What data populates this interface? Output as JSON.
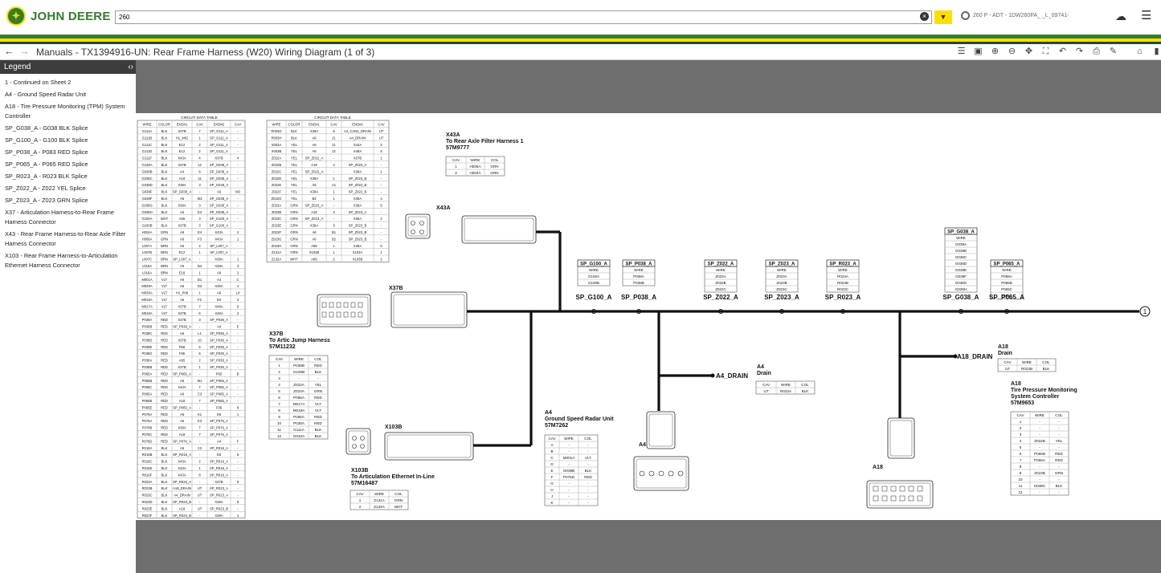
{
  "header": {
    "brand": "JOHN DEERE",
    "search_value": "260",
    "machine": "260 P - ADT - 1DW260PA_ _L_09741-"
  },
  "document": {
    "title": "Manuals - TX1394916-UN: Rear Frame Harness (W20) Wiring Diagram (1 of 3)"
  },
  "legend": {
    "title": "Legend",
    "items": [
      "1 - Continued on Sheet 2",
      "A4 - Ground Speed Radar Unit",
      "A18 - Tire Pressure Monitoring (TPM) System Controller",
      "SP_G038_A - G038 BLK Splice",
      "SP_G100_A - G100 BLK Splice",
      "SP_P038_A - P083 RED Splice",
      "SP_P065_A - P065 RED Splice",
      "SP_R023_A - R023 BLK Splice",
      "SP_Z022_A - Z022 YEL Splice",
      "SP_Z023_A - Z023 GRN Splice",
      "X37 - Articulation Harness-to-Rear Frame Harness Connector",
      "X43 - Rear Frame Harness-to-Rear Axle Filter Harness Connector",
      "X103 - Rear Frame Harness-to-Articulation Ethernet Harness Connector"
    ]
  },
  "diagram": {
    "table_title": "CIRCUIT DATA TABLE",
    "circuit_headers": [
      "WIRE",
      "COLOR",
      "END#1",
      "CAV",
      "END#2",
      "CAV"
    ],
    "cdt1_rows": [
      [
        "G111A",
        "BLK",
        "X37B",
        "7",
        "SP_G111_A",
        "-"
      ],
      [
        "G111B",
        "BLK",
        "H1_MIG",
        "1",
        "SP_G111_A",
        "-"
      ],
      [
        "G111C",
        "BLK",
        "E12",
        "2",
        "SP_G111_A",
        "-"
      ],
      [
        "G111D",
        "BLK",
        "E12",
        "2",
        "SP_G111_A",
        "-"
      ],
      [
        "G111F",
        "BLK",
        "X43A",
        "4",
        "X37B",
        "4"
      ],
      [
        "G138A",
        "BLK",
        "X37B",
        "12",
        "SP_G038_A",
        "-"
      ],
      [
        "G038B",
        "BLK",
        "A4",
        "6",
        "SP_G038_A",
        "-"
      ],
      [
        "G038C",
        "BLK",
        "A18",
        "11",
        "SP_G038_A",
        "-"
      ],
      [
        "G038D",
        "BLK",
        "X38A",
        "3",
        "SP_G038_A",
        "-"
      ],
      [
        "G038F",
        "BLK",
        "SP_G038_A",
        "-",
        "A6",
        "M3"
      ],
      [
        "G038F",
        "BLK",
        "A6",
        "M3",
        "SP_G038_A",
        "-"
      ],
      [
        "G038G",
        "BLK",
        "X38A",
        "3",
        "SP_G038_A",
        "-"
      ],
      [
        "G038H",
        "BLK",
        "A6",
        "E3",
        "SP_G038_A",
        "-"
      ],
      [
        "G100A",
        "WHT",
        "A65",
        "3",
        "SP_G100_A",
        "-"
      ],
      [
        "G100B",
        "BLK",
        "X37B",
        "3",
        "SP_G100_A",
        "-"
      ],
      [
        "H004A",
        "GRN",
        "A6",
        "E4",
        "X43A",
        "2"
      ],
      [
        "H006A",
        "GRN",
        "A6",
        "F3",
        "X43A",
        "1"
      ],
      [
        "L007A",
        "BRN",
        "A6",
        "2",
        "SP_L007_A",
        "-"
      ],
      [
        "L007B",
        "BRN",
        "E12",
        "1",
        "SP_L007_A",
        "-"
      ],
      [
        "L007C",
        "BRN",
        "SP_L007_A",
        "-",
        "X38A",
        "1"
      ],
      [
        "L016A",
        "BRN",
        "A6",
        "B4",
        "X48A",
        "3"
      ],
      [
        "L016A",
        "BRN",
        "E16",
        "1",
        "A6",
        "2"
      ],
      [
        "M001A",
        "VLT",
        "A6",
        "D1",
        "A4",
        "C"
      ],
      [
        "M029A",
        "VLT",
        "A6",
        "D3",
        "X48A",
        "4"
      ],
      [
        "M030A",
        "VLT",
        "H1_P06",
        "1",
        "A6",
        "L4"
      ],
      [
        "M016A",
        "VLT",
        "A6",
        "F2",
        "B4",
        "2"
      ],
      [
        "M017A",
        "VLT",
        "X37B",
        "7",
        "X48A",
        "6"
      ],
      [
        "M018A",
        "VLT",
        "X37B",
        "6",
        "X48A",
        "2"
      ],
      [
        "P038A",
        "RED",
        "X37B",
        "3",
        "SP_P038_A",
        "-"
      ],
      [
        "P038B",
        "RED",
        "SP_P038_A",
        "-",
        "A4",
        "E"
      ],
      [
        "P038C",
        "RED",
        "A6",
        "L1",
        "SP_P038_A",
        "-"
      ],
      [
        "P038D",
        "RED",
        "X37B",
        "10",
        "SP_P038_A",
        "-"
      ],
      [
        "P038E",
        "RED",
        "P66",
        "6",
        "SP_P038_A",
        "-"
      ],
      [
        "P038G",
        "RED",
        "F65",
        "5",
        "SP_P038_A",
        "-"
      ],
      [
        "P038A",
        "RED",
        "A65",
        "2",
        "SP_P038_A",
        "-"
      ],
      [
        "P038B",
        "RED",
        "X37B",
        "1",
        "SP_P038_A",
        "-"
      ],
      [
        "P065A",
        "RED",
        "SP_P065_A",
        "-",
        "P65",
        "B"
      ],
      [
        "P065B",
        "RED",
        "A6",
        "M1",
        "SP_P065_A",
        "-"
      ],
      [
        "P065C",
        "RED",
        "X43A",
        "7",
        "SP_P065_A",
        "-"
      ],
      [
        "P065A",
        "RED",
        "A6",
        "C3",
        "SP_P065_A",
        "-"
      ],
      [
        "P065B",
        "RED",
        "A18",
        "7",
        "SP_P065_A",
        "-"
      ],
      [
        "P065E",
        "RED",
        "SP_P065_A",
        "-",
        "F65",
        "8"
      ],
      [
        "P076A",
        "RED",
        "A6",
        "K1",
        "E8",
        "1"
      ],
      [
        "P076A",
        "RED",
        "A6",
        "K3",
        "SP_P076_A",
        "-"
      ],
      [
        "P076B",
        "RED",
        "X38A",
        "7",
        "SP_P076_A",
        "-"
      ],
      [
        "P076C",
        "RED",
        "A18",
        "7",
        "SP_P076_A",
        "-"
      ],
      [
        "P076D",
        "RED",
        "SP_P076_A",
        "-",
        "A4",
        "F"
      ],
      [
        "R016A",
        "BLK",
        "A6",
        "C2",
        "SP_R016_A",
        "-"
      ],
      [
        "R016B",
        "BLK",
        "SP_R016_A",
        "-",
        "E6",
        "5"
      ],
      [
        "R016C",
        "BLK",
        "X43A",
        "2",
        "SP_R016_A",
        "-"
      ],
      [
        "R016E",
        "BLK",
        "X43A",
        "1",
        "SP_R016_A",
        "-"
      ],
      [
        "R016F",
        "BLK",
        "X43A",
        "8",
        "SP_R016_A",
        "-"
      ],
      [
        "R023A",
        "BLK",
        "SP_R023_A",
        "-",
        "X37B",
        "8"
      ],
      [
        "R023B",
        "BLK",
        "A18_DRAIN",
        "UT",
        "SP_R023_A",
        "-"
      ],
      [
        "R023C",
        "BLK",
        "A4_DRAIN",
        "UT",
        "SP_R023_A",
        "-"
      ],
      [
        "R023D",
        "BLK",
        "SP_R023_B",
        "-",
        "X38A",
        "8"
      ],
      [
        "R023E",
        "BLK",
        "A18",
        "UT",
        "SP_R023_B",
        "-"
      ],
      [
        "R023F",
        "BLK",
        "SP_R023_B",
        "-",
        "X38A",
        "1"
      ]
    ],
    "cdt2_rows": [
      [
        "R003G",
        "BLK",
        "X38A",
        "8",
        "A4_CAN2_DRAIN",
        "UT"
      ],
      [
        "R003H",
        "BLK",
        "A6",
        "J1",
        "A4_DRAIN",
        "UT"
      ],
      [
        "X003A",
        "YEL",
        "A6",
        "J1",
        "X44A",
        "3"
      ],
      [
        "X003B",
        "YEL",
        "A6",
        "J2",
        "X48A",
        "5"
      ],
      [
        "Z022A",
        "YEL",
        "SP_Z022_A",
        "-",
        "X37B",
        "1"
      ],
      [
        "Z022B",
        "YEL",
        "A18",
        "4",
        "SP_Z022_A",
        "-"
      ],
      [
        "Z022C",
        "YEL",
        "SP_Z022_A",
        "-",
        "X38A",
        "1"
      ],
      [
        "Z022D",
        "YEL",
        "X38A",
        "1",
        "SP_Z022_B",
        "-"
      ],
      [
        "Z022E",
        "YEL",
        "A6",
        "A1",
        "SP_Z022_B",
        "-"
      ],
      [
        "Z022F",
        "YEL",
        "X38A",
        "1",
        "SP_Z022_B",
        "-"
      ],
      [
        "Z022G",
        "YEL",
        "B4",
        "1",
        "X38A",
        "4"
      ],
      [
        "Z023A",
        "GRN",
        "SP_Z023_A",
        "-",
        "X38A",
        "5"
      ],
      [
        "Z023B",
        "GRN",
        "A18",
        "3",
        "SP_Z023_A",
        "-"
      ],
      [
        "Z023C",
        "GRN",
        "SP_Z023_A",
        "-",
        "X38A",
        "2"
      ],
      [
        "Z023E",
        "GRN",
        "X38A",
        "3",
        "SP_Z023_B",
        "-"
      ],
      [
        "Z023F",
        "GRN",
        "A6",
        "B1",
        "SP_Z023_B",
        "-"
      ],
      [
        "Z023G",
        "GRN",
        "A6",
        "B2",
        "SP_Z023_B",
        "-"
      ],
      [
        "Z023H",
        "GRN",
        "A65",
        "1",
        "X38A",
        "5"
      ],
      [
        "Z131A",
        "GRN",
        "X103B",
        "1",
        "X103A",
        "1"
      ],
      [
        "Z132A",
        "WHT",
        "A65",
        "2",
        "X103B",
        "2"
      ]
    ],
    "x43a": {
      "callout": "X43A",
      "title1": "X43A",
      "title2": "To Rear Axle Filter Harness 1",
      "part": "57M9777",
      "headers": [
        "CAV",
        "WIRE",
        "COL"
      ],
      "rows": [
        [
          "1",
          "H006A",
          "GRN"
        ],
        [
          "2",
          "H004A",
          "GRN"
        ]
      ]
    },
    "x37b": {
      "callout": "X37B",
      "title1": "X37B",
      "title2": "To Artic Jump Harness",
      "part": "57M11232",
      "headers": [
        "CAV",
        "WIRE",
        "COL"
      ],
      "rows": [
        [
          "1",
          "P038B",
          "RED"
        ],
        [
          "2",
          "G100B",
          "BLK"
        ],
        [
          "3",
          "-",
          "-"
        ],
        [
          "4",
          "Z022A",
          "YEL"
        ],
        [
          "5",
          "Z023A",
          "GRN"
        ],
        [
          "6",
          "P065A",
          "RED"
        ],
        [
          "7",
          "M017A",
          "VLT"
        ],
        [
          "8",
          "M018A",
          "VLT"
        ],
        [
          "9",
          "P066A",
          "RED"
        ],
        [
          "10",
          "P038A",
          "RED"
        ],
        [
          "11",
          "G111A",
          "BLK"
        ],
        [
          "12",
          "G033A",
          "BLK"
        ]
      ]
    },
    "x103b": {
      "callout": "X103B",
      "title1": "X103B",
      "title2": "To Articulation Ethernet In-Line",
      "part": "57M16487",
      "headers": [
        "CAV",
        "WIRE",
        "COL"
      ],
      "rows": [
        [
          "1",
          "Z131A",
          "GRN"
        ],
        [
          "2",
          "Z132A",
          "WHT"
        ]
      ]
    },
    "a4": {
      "callout": "A4",
      "title1": "A4",
      "title2": "Ground Speed Radar Unit",
      "part": "57M7262",
      "headers": [
        "CAV",
        "WIPE",
        "COL"
      ],
      "rows": [
        [
          "A",
          "-",
          "-"
        ],
        [
          "B",
          "-",
          "-"
        ],
        [
          "C",
          "M001A",
          "VLT"
        ],
        [
          "D",
          "-",
          "-"
        ],
        [
          "E",
          "G038B",
          "BLK"
        ],
        [
          "F",
          "P076D",
          "RED"
        ],
        [
          "G",
          "-",
          "-"
        ],
        [
          "H",
          "-",
          "-"
        ],
        [
          "J",
          "-",
          "-"
        ],
        [
          "K",
          "-",
          "-"
        ]
      ]
    },
    "a4_drain": {
      "label": "A4_DRAIN",
      "title1": "A4",
      "title2": "Drain",
      "headers": [
        "CAV",
        "WIRE",
        "COL"
      ],
      "rows": [
        [
          "UT",
          "R023A",
          "BLK"
        ]
      ]
    },
    "a18_drain": {
      "label": "A18_DRAIN",
      "title1": "A18",
      "title2": "Drain",
      "headers": [
        "CAV",
        "WIRE",
        "COL"
      ],
      "rows": [
        [
          "UT",
          "R023B",
          "BLK"
        ]
      ]
    },
    "a18": {
      "callout": "A18",
      "title1": "A18",
      "title2": "Tire Pressure Monitoring",
      "title3": "System Controller",
      "part": "57M9653",
      "headers": [
        "CAV",
        "WIRE",
        "COL"
      ],
      "rows": [
        [
          "1",
          "-",
          "-"
        ],
        [
          "2",
          "-",
          "-"
        ],
        [
          "3",
          "-",
          "-"
        ],
        [
          "4",
          "Z022B",
          "YEL"
        ],
        [
          "5",
          "-",
          "-"
        ],
        [
          "6",
          "P065B",
          "RED"
        ],
        [
          "7",
          "P065A",
          "RED"
        ],
        [
          "8",
          "-",
          "-"
        ],
        [
          "9",
          "Z023B",
          "GRN"
        ],
        [
          "10",
          "-",
          "-"
        ],
        [
          "11",
          "G038C",
          "BLK"
        ],
        [
          "12",
          "-",
          "-"
        ]
      ]
    },
    "splices": [
      {
        "name": "SP_G100_A",
        "wires": [
          "WIRE",
          "G100A",
          "G100B"
        ]
      },
      {
        "name": "SP_P038_A",
        "wires": [
          "WIRE",
          "P038A",
          "P038B"
        ]
      },
      {
        "name": "SP_Z022_A",
        "wires": [
          "WIRE",
          "Z022A",
          "Z022B",
          "Z022C"
        ]
      },
      {
        "name": "SP_Z023_A",
        "wires": [
          "WIRE",
          "Z023A",
          "Z023B",
          "Z023C"
        ]
      },
      {
        "name": "SP_R023_A",
        "wires": [
          "WIRE",
          "R023A",
          "R023B",
          "R023C"
        ]
      },
      {
        "name": "SP_G038_A",
        "wires": [
          "WIRE",
          "G038A",
          "G038B",
          "G038C",
          "G038D",
          "G038E",
          "G038F",
          "G038G",
          "G038H"
        ]
      },
      {
        "name": "SP_P065_A",
        "wires": [
          "WIRE",
          "P065A",
          "P065B",
          "P065C",
          "P065D"
        ]
      }
    ],
    "sheet_ref": "1"
  }
}
